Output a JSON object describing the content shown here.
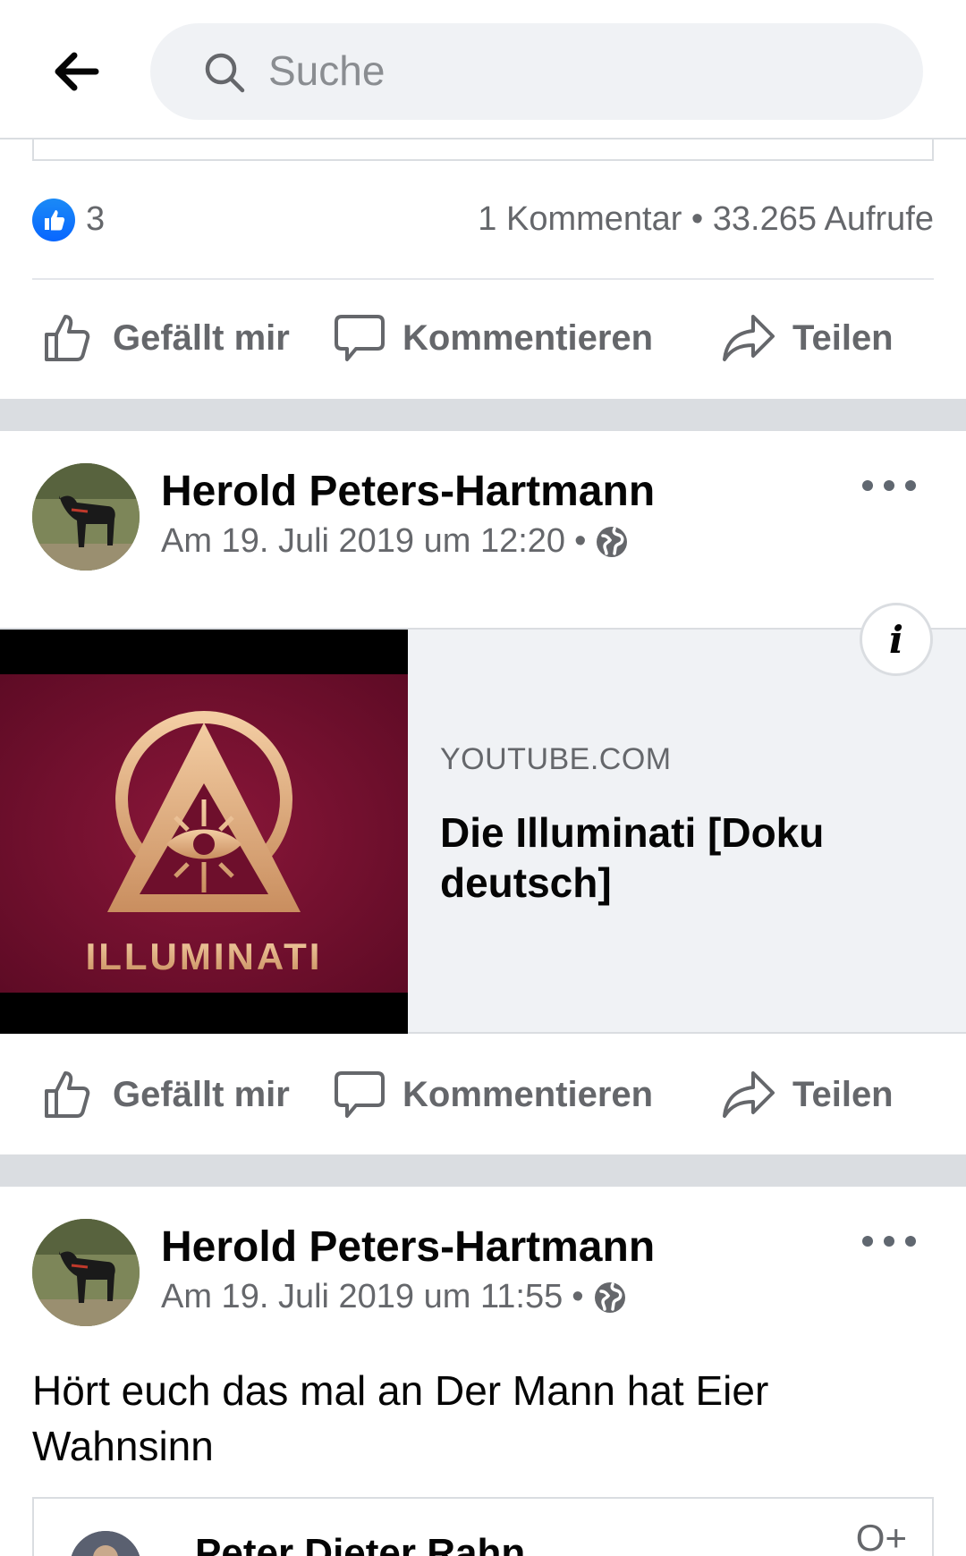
{
  "search": {
    "placeholder": "Suche"
  },
  "post1": {
    "like_count": "3",
    "stats_right": "1 Kommentar • 33.265 Aufrufe"
  },
  "actions": {
    "like": "Gefällt mir",
    "comment": "Kommentieren",
    "share": "Teilen"
  },
  "post2": {
    "author": "Herold Peters-Hartmann",
    "time": "Am 19. Juli 2019 um 12:20",
    "link": {
      "source": "YOUTUBE.COM",
      "title": "Die Illuminati [Doku deutsch]",
      "thumb_text": "ILLUMINATI"
    }
  },
  "post3": {
    "author": "Herold Peters-Hartmann",
    "time": "Am 19. Juli 2019 um 11:55",
    "text": "Hört euch das mal an Der Mann hat Eier Wahnsinn",
    "shared": {
      "name": "Peter Dieter Rahn",
      "follow": "O+"
    }
  },
  "colors": {
    "accent": "#0866ff",
    "secondary_text": "#65676b",
    "separator": "#dadde1",
    "thumb_bg": "#7a1030",
    "thumb_gold": "#e8b98c"
  },
  "icons": [
    "back-arrow-icon",
    "search-icon",
    "like-badge-icon",
    "thumbs-up-icon",
    "comment-icon",
    "share-icon",
    "more-icon",
    "globe-icon",
    "info-icon"
  ]
}
